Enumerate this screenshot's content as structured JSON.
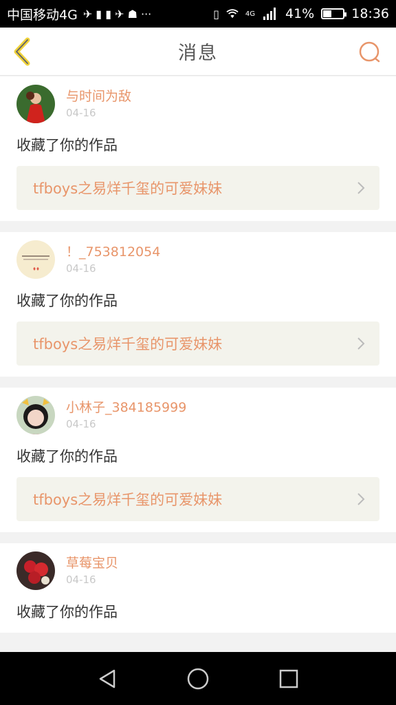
{
  "status_bar": {
    "carrier": "中国移动4G",
    "battery_percent": "41%",
    "time": "18:36",
    "network": "4G",
    "icons": [
      "sim-icon",
      "notification-icon",
      "vibrate-icon",
      "wifi-icon",
      "signal-icon",
      "battery-icon"
    ],
    "battery_level": 0.41
  },
  "header": {
    "title": "消息",
    "back_icon": "back-chevron-icon",
    "search_icon": "search-icon",
    "accent_color": "#e8956a"
  },
  "messages": [
    {
      "username": "与时间为敌",
      "date": "04-16",
      "action": "收藏了你的作品",
      "work_title": "tfboys之易烊千玺的可爱妹妹"
    },
    {
      "username": "！_753812054",
      "date": "04-16",
      "action": "收藏了你的作品",
      "work_title": "tfboys之易烊千玺的可爱妹妹"
    },
    {
      "username": "小林子_384185999",
      "date": "04-16",
      "action": "收藏了你的作品",
      "work_title": "tfboys之易烊千玺的可爱妹妹"
    },
    {
      "username": "草莓宝贝",
      "date": "04-16",
      "action": "收藏了你的作品",
      "work_title": ""
    }
  ],
  "nav": {
    "buttons": [
      "back-triangle-icon",
      "home-circle-icon",
      "recents-square-icon"
    ]
  }
}
